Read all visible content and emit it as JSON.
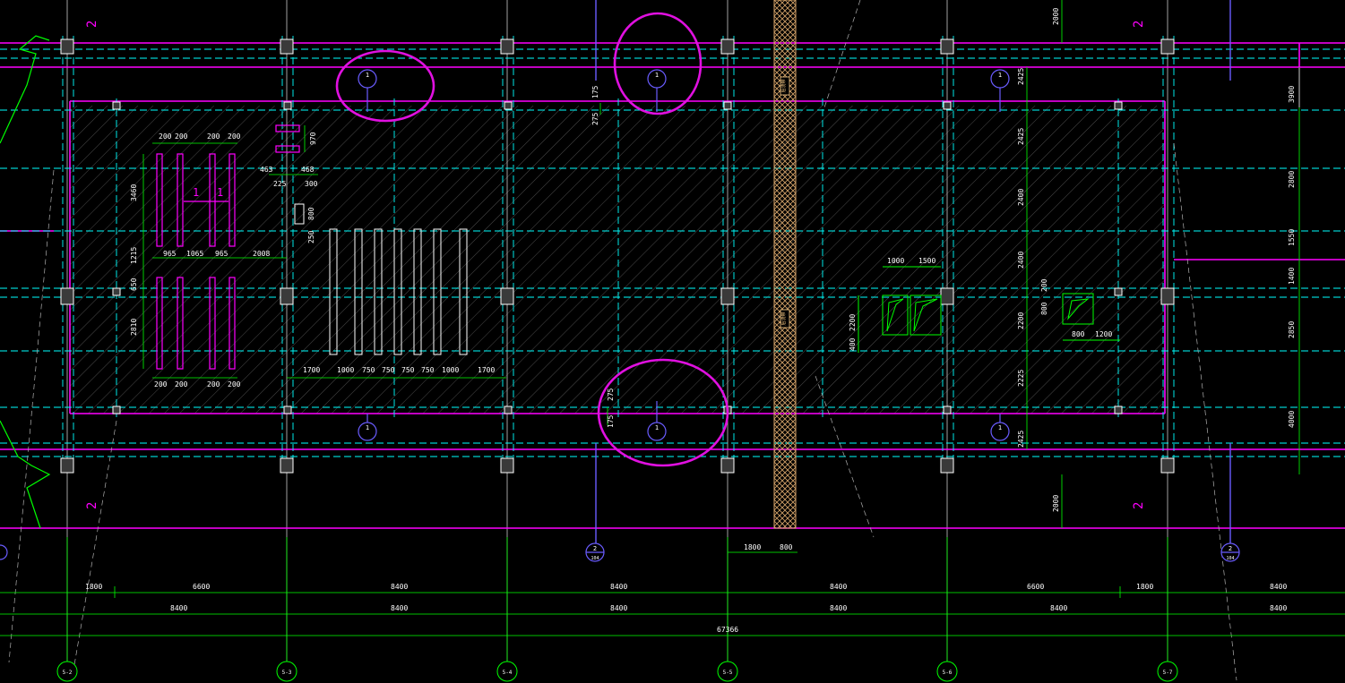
{
  "colors": {
    "background": "#000000",
    "beam_magenta": "#ff00ff",
    "axis_cyan": "#00ffff",
    "dimension_green": "#00ff00",
    "column_white": "#ffffff",
    "grid_gray": "#c8c8c8",
    "strip_hatch": "#ffd08a",
    "section_blue": "#6a5cff",
    "highlight_circle": "#e010e0"
  },
  "axis_labels": [
    "5-2",
    "5-3",
    "5-4",
    "5-5",
    "5-6",
    "5-7"
  ],
  "bottom_dims": {
    "row1": [
      "1800",
      "6600",
      "8400",
      "8400",
      "8400",
      "6600",
      "1800",
      "8400"
    ],
    "row2": [
      "8400",
      "8400",
      "8400",
      "8400",
      "8400",
      "8400"
    ],
    "total": "67366"
  },
  "right_dims": [
    "3900",
    "2800",
    "1550",
    "1400",
    "2850",
    "4000"
  ],
  "section_marker_dims": [
    "2000",
    "2000"
  ],
  "grid_callouts": [
    {
      "top": "2",
      "bottom": "104"
    },
    {
      "top": "2",
      "bottom": "104"
    }
  ],
  "section_labels": {
    "top_left": "2",
    "top_right": "2",
    "bottom_left": "2",
    "bottom_right": "2",
    "bubble": "1"
  },
  "vertical_slab_dims": [
    "2425",
    "2425",
    "2400",
    "2400",
    "2200",
    "2225",
    "2425"
  ],
  "left_block": {
    "top_spacing": [
      "200",
      "200",
      "200",
      "200"
    ],
    "bottom_spacing": [
      "200",
      "200",
      "200",
      "200"
    ],
    "mark": "1",
    "horizontal": [
      "965",
      "1065",
      "965",
      "2008"
    ],
    "vertical": [
      "3460",
      "1215",
      "650",
      "2810"
    ]
  },
  "middle_block": {
    "small_dims": [
      "970",
      "463",
      "468",
      "225",
      "300",
      "800",
      "250"
    ],
    "bottom_dims": [
      "1700",
      "1000",
      "750",
      "750",
      "750",
      "750",
      "1000",
      "1700"
    ],
    "upper_dims": [
      "175",
      "275"
    ],
    "lower_dims": [
      "175",
      "275"
    ]
  },
  "right_block": {
    "top": [
      "1000",
      "1500"
    ],
    "left": [
      "400",
      "2200"
    ],
    "right_top": "200",
    "right_left": "800",
    "bottom": [
      "800",
      "1200"
    ]
  },
  "strip_labels": [
    "后浇带",
    "后浇带"
  ],
  "bottom_center_dims": [
    "1800",
    "800"
  ]
}
